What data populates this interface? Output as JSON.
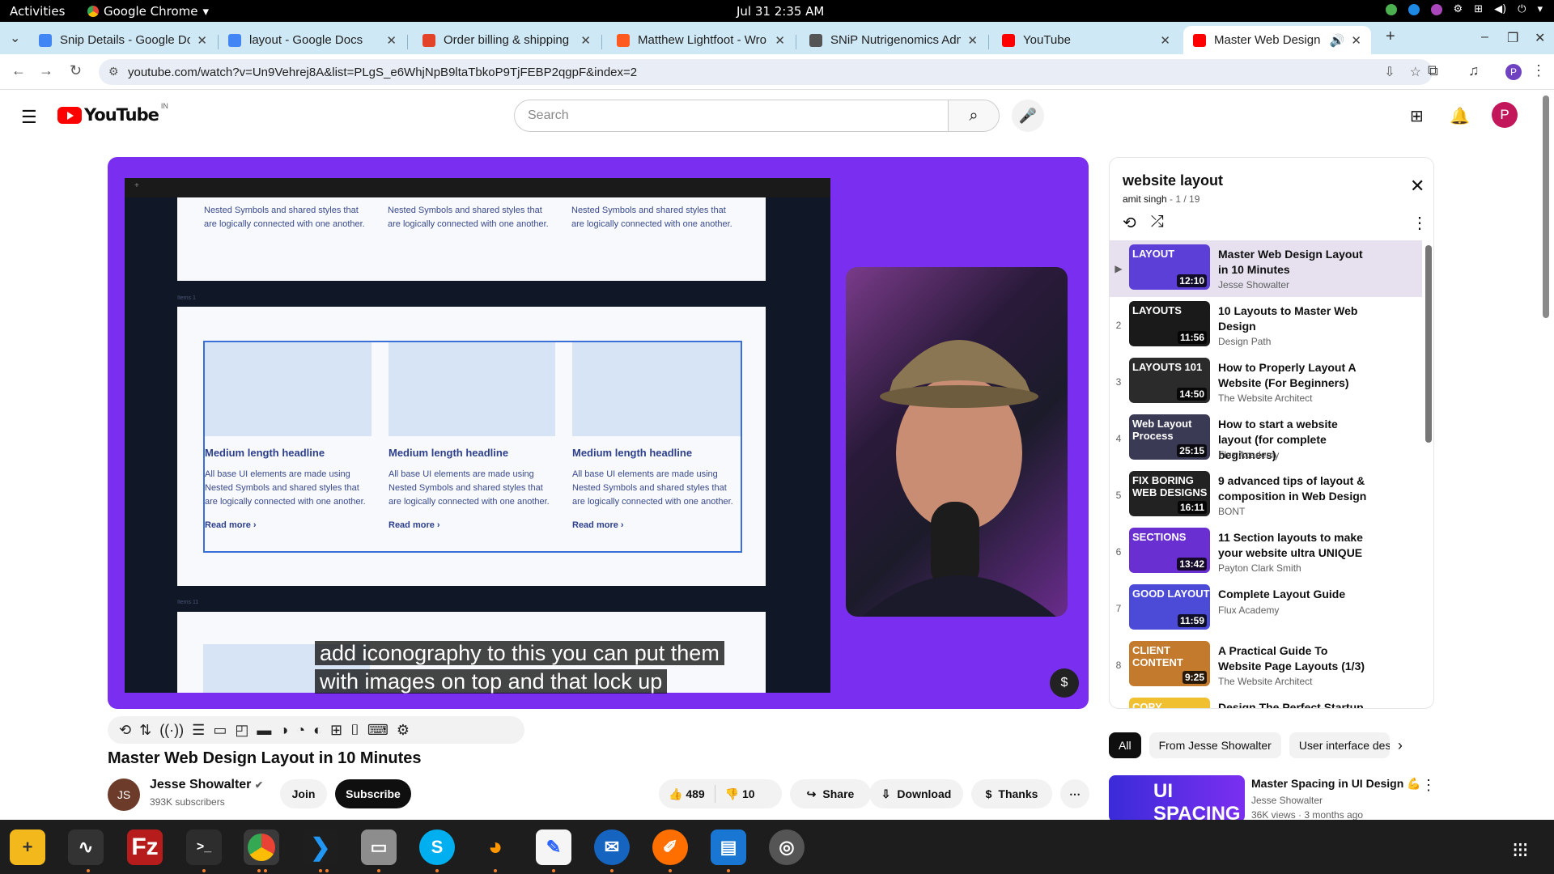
{
  "system": {
    "activities": "Activities",
    "app_name": "Google Chrome",
    "clock": "Jul 31  2:35 AM"
  },
  "tabs": [
    {
      "title": "Snip Details - Google Do",
      "color": "#4285f4"
    },
    {
      "title": "layout - Google Docs",
      "color": "#4285f4"
    },
    {
      "title": "Order billing & shipping",
      "color": "#e24329"
    },
    {
      "title": "Matthew Lightfoot - Wro",
      "color": "#ff5a1f"
    },
    {
      "title": "SNiP Nutrigenomics Adm",
      "color": "#555555"
    },
    {
      "title": "YouTube",
      "color": "#ff0000"
    },
    {
      "title": "Master Web Design L",
      "color": "#ff0000"
    }
  ],
  "address": {
    "url": "youtube.com/watch?v=Un9Vehrej8A&list=PLgS_e6WhjNpB9ltaTbkoP9TjFEBP2qgpF&index=2"
  },
  "yt": {
    "logo": "YouTube",
    "country": "IN",
    "search_placeholder": "Search",
    "avatar": "P"
  },
  "slide": {
    "top_text": "Nested Symbols and shared styles that are logically connected with one another.",
    "items_label_1": "Items 1",
    "items_label_2": "Items 11",
    "headline": "Medium length headline",
    "body": "All base UI elements are made using Nested Symbols and shared styles that are logically connected with one another.",
    "read_more": "Read more ›"
  },
  "caption": {
    "line1": "add iconography to this you can put them",
    "line2": "with images on top and that lock up"
  },
  "video": {
    "title": "Master Web Design Layout in 10 Minutes",
    "channel": "Jesse Showalter",
    "subs": "393K subscribers",
    "join": "Join",
    "subscribe": "Subscribe",
    "likes": "489",
    "dislikes": "10",
    "share": "Share",
    "download": "Download",
    "thanks": "Thanks"
  },
  "playlist": {
    "title": "website layout",
    "owner": "amit singh",
    "position": " - 1 / 19",
    "items": [
      {
        "idx": "▶",
        "title": "Master Web Design Layout in 10 Minutes",
        "channel": "Jesse Showalter",
        "dur": "12:10",
        "thumb": "LAYOUT",
        "bg": "#5b3fd6"
      },
      {
        "idx": "2",
        "title": "10 Layouts to Master Web Design",
        "channel": "Design Path",
        "dur": "11:56",
        "thumb": "LAYOUTS",
        "bg": "#1a1a1a"
      },
      {
        "idx": "3",
        "title": "How to Properly Layout A Website (For Beginners)",
        "channel": "The Website Architect",
        "dur": "14:50",
        "thumb": "LAYOUTS 101",
        "bg": "#2b2b2b"
      },
      {
        "idx": "4",
        "title": "How to start a website layout (for complete beginners)",
        "channel": "Flux Academy",
        "dur": "25:15",
        "thumb": "Web Layout Process",
        "bg": "#3a3a55"
      },
      {
        "idx": "5",
        "title": "9 advanced tips of layout & composition in Web Design",
        "channel": "BONT",
        "dur": "16:11",
        "thumb": "FIX BORING WEB DESIGNS",
        "bg": "#222222"
      },
      {
        "idx": "6",
        "title": "11 Section layouts to make your website ultra UNIQUE",
        "channel": "Payton Clark Smith",
        "dur": "13:42",
        "thumb": "SECTIONS",
        "bg": "#6a2fd0"
      },
      {
        "idx": "7",
        "title": "Complete Layout Guide",
        "channel": "Flux Academy",
        "dur": "11:59",
        "thumb": "GOOD LAYOUT",
        "bg": "#4b4bd8"
      },
      {
        "idx": "8",
        "title": "A Practical Guide To Website Page Layouts (1/3)",
        "channel": "The Website Architect",
        "dur": "9:25",
        "thumb": "CLIENT CONTENT",
        "bg": "#c47a2c"
      },
      {
        "idx": "",
        "title": "Design The Perfect Startup",
        "channel": "",
        "dur": "",
        "thumb": "COPY",
        "bg": "#f0c030"
      }
    ]
  },
  "chips": [
    "All",
    "From Jesse Showalter",
    "User interface desi"
  ],
  "recommended": {
    "thumb": "UI SPACING",
    "title": "Master Spacing in UI Design 💪",
    "channel": "Jesse Showalter",
    "views": "36K views · 3 months ago"
  }
}
